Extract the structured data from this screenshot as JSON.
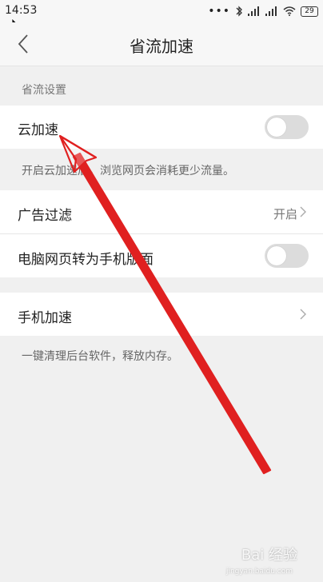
{
  "status_bar": {
    "time": "14:53",
    "dots": "•••",
    "battery": "29"
  },
  "nav": {
    "title": "省流加速"
  },
  "section": {
    "header": "省流设置"
  },
  "rows": {
    "cloud_speedup": {
      "label": "云加速",
      "toggle_on": false
    },
    "cloud_hint": "开启云加速后，浏览网页会消耗更少流量。",
    "ad_filter": {
      "label": "广告过滤",
      "value": "开启"
    },
    "desktop_to_mobile": {
      "label": "电脑网页转为手机版面",
      "toggle_on": false
    },
    "phone_speedup": {
      "label": "手机加速"
    },
    "phone_hint": "一键清理后台软件，释放内存。"
  },
  "annotation": {
    "arrow_color": "#e02020"
  },
  "watermark": {
    "brand": "Bai 经验",
    "sub": "jingyan.baidu.com"
  },
  "colors": {
    "background": "#f0f0f0",
    "row_bg": "#ffffff",
    "toggle_off": "#dcdcdc"
  }
}
